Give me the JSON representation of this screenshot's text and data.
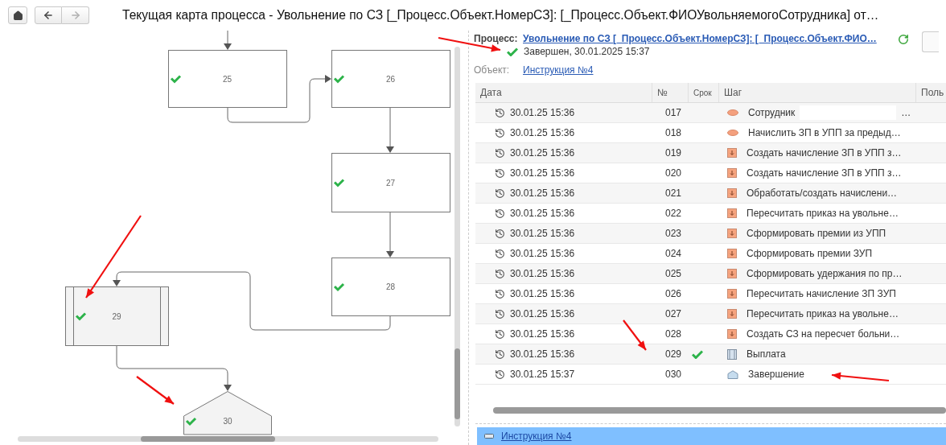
{
  "toolbar": {
    "back_disabled": false,
    "forward_disabled": true,
    "title": "Текущая карта процесса - Увольнение по СЗ [_Процесс.Объект.НомерСЗ]: [_Процесс.Объект.ФИОУвольняемогоСотрудника] от…"
  },
  "diagram": {
    "nodes": [
      {
        "label": "25",
        "kind": "task",
        "done": true
      },
      {
        "label": "26",
        "kind": "task",
        "done": true
      },
      {
        "label": "27",
        "kind": "task",
        "done": true
      },
      {
        "label": "28",
        "kind": "task",
        "done": true
      },
      {
        "label": "29",
        "kind": "subprocess",
        "done": true
      },
      {
        "label": "30",
        "kind": "end",
        "done": true
      }
    ]
  },
  "process": {
    "label": "Процесс:",
    "name": "Увольнение по СЗ [_Процесс.Объект.НомерСЗ]: [_Процесс.Объект.ФИО…",
    "completed": true,
    "status": "Завершен, 30.01.2025 15:37"
  },
  "object": {
    "label": "Объект:",
    "value": "Инструкция №4"
  },
  "table": {
    "columns": [
      "Дата",
      "№",
      "Срок",
      "Шаг",
      "Поль"
    ],
    "rows": [
      {
        "date": "30.01.25 15:36",
        "number": "017",
        "on_time": false,
        "kind": "start",
        "step": "Сотрудник",
        "tail": "…"
      },
      {
        "date": "30.01.25 15:36",
        "number": "018",
        "on_time": false,
        "kind": "start",
        "step": "Начислить ЗП в УПП за предыд…"
      },
      {
        "date": "30.01.25 15:36",
        "number": "019",
        "on_time": false,
        "kind": "action",
        "step": "Создать начисление ЗП в УПП з…"
      },
      {
        "date": "30.01.25 15:36",
        "number": "020",
        "on_time": false,
        "kind": "action",
        "step": "Создать начисление ЗП в УПП з…"
      },
      {
        "date": "30.01.25 15:36",
        "number": "021",
        "on_time": false,
        "kind": "action",
        "step": "Обработать/создать начислени…"
      },
      {
        "date": "30.01.25 15:36",
        "number": "022",
        "on_time": false,
        "kind": "action",
        "step": "Пересчитать приказ на увольне…"
      },
      {
        "date": "30.01.25 15:36",
        "number": "023",
        "on_time": false,
        "kind": "action",
        "step": "Сформировать премии из УПП"
      },
      {
        "date": "30.01.25 15:36",
        "number": "024",
        "on_time": false,
        "kind": "action",
        "step": "Сформировать премии ЗУП"
      },
      {
        "date": "30.01.25 15:36",
        "number": "025",
        "on_time": false,
        "kind": "action",
        "step": "Сформировать удержания по пр…"
      },
      {
        "date": "30.01.25 15:36",
        "number": "026",
        "on_time": false,
        "kind": "action",
        "step": "Пересчитать начисление ЗП ЗУП"
      },
      {
        "date": "30.01.25 15:36",
        "number": "027",
        "on_time": false,
        "kind": "action",
        "step": "Пересчитать приказ на увольне…"
      },
      {
        "date": "30.01.25 15:36",
        "number": "028",
        "on_time": false,
        "kind": "action",
        "step": "Создать СЗ на пересчет больни…"
      },
      {
        "date": "30.01.25 15:36",
        "number": "029",
        "on_time": true,
        "kind": "subprocess",
        "step": "Выплата"
      },
      {
        "date": "30.01.25 15:37",
        "number": "030",
        "on_time": false,
        "kind": "end",
        "step": "Завершение"
      }
    ]
  },
  "group_row": {
    "expanded": true,
    "label": "Инструкция №4"
  }
}
